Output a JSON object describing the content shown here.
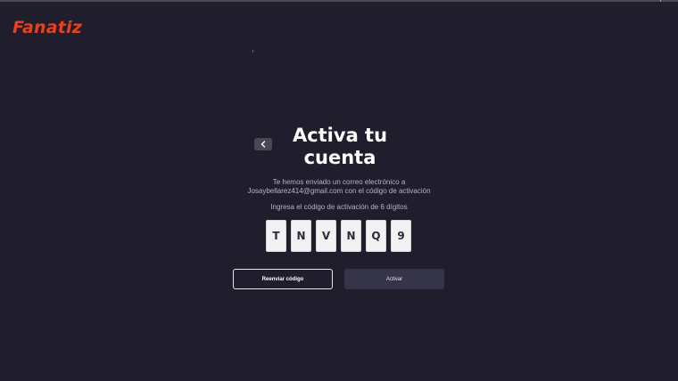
{
  "brand": {
    "name": "Fanatiz",
    "color": "#e8401e"
  },
  "header": {
    "back_icon": "chevron-left-icon",
    "title_line1": "Activa tu",
    "title_line2": "cuenta"
  },
  "message": {
    "line1": "Te hemos enviado un correo electrónico a",
    "line2": "Josaybellarez414@gmail.com con el código de activación"
  },
  "code_prompt": "Ingresa el código de activación de 6 dígitos",
  "code_digits": [
    "T",
    "N",
    "V",
    "N",
    "Q",
    "9"
  ],
  "buttons": {
    "resend_label": "Reenviar código",
    "activate_label": "Activar"
  },
  "colors": {
    "background": "#201d2c",
    "activate_button": "#363448",
    "code_box": "#f2f2f4"
  }
}
